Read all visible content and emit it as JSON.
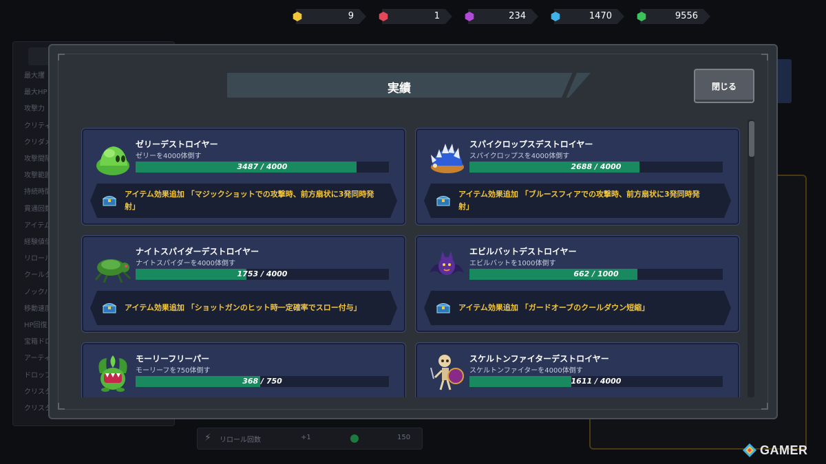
{
  "currency": [
    {
      "name": "yellow-gem",
      "value": "9",
      "color": "#f2c53a"
    },
    {
      "name": "red-gem",
      "value": "1",
      "color": "#e2475a"
    },
    {
      "name": "purple-gem",
      "value": "234",
      "color": "#b24ad8"
    },
    {
      "name": "blue-gem",
      "value": "1470",
      "color": "#3fb2e8"
    },
    {
      "name": "green-gem",
      "value": "9556",
      "color": "#3cc25a"
    }
  ],
  "modal": {
    "title": "実績",
    "close_label": "閉じる"
  },
  "achievements": [
    {
      "name": "ゼリーデストロイヤー",
      "desc": "ゼリーを4000体倒す",
      "progress": 3487,
      "goal": 4000,
      "progress_text": "3487 / 4000",
      "reward_1": "アイテム効果追加 「マジックショットでの攻撃時、前方扇状に3発同時発",
      "reward_2": "射」",
      "icon": "green-slime-icon"
    },
    {
      "name": "スパイクロップスデストロイヤー",
      "desc": "スパイクロップスを4000体倒す",
      "progress": 2688,
      "goal": 4000,
      "progress_text": "2688 / 4000",
      "reward_1": "アイテム効果追加 「ブルースフィアでの攻撃時、前方扇状に3発同時発",
      "reward_2": "射」",
      "icon": "spiked-shell-icon"
    },
    {
      "name": "ナイトスパイダーデストロイヤー",
      "desc": "ナイトスパイダーを4000体倒す",
      "progress": 1753,
      "goal": 4000,
      "progress_text": "1753 / 4000",
      "reward_1": "アイテム効果追加 「ショットガンのヒット時一定確率でスロー付与」",
      "reward_2": "",
      "icon": "green-spider-icon"
    },
    {
      "name": "エビルバットデストロイヤー",
      "desc": "エビルバットを1000体倒す",
      "progress": 662,
      "goal": 1000,
      "progress_text": "662 / 1000",
      "reward_1": "アイテム効果追加 「ガードオーブのクールダウン短縮」",
      "reward_2": "",
      "icon": "purple-bat-icon"
    },
    {
      "name": "モーリーフリーパー",
      "desc": "モーリーフを750体倒す",
      "progress": 368,
      "goal": 750,
      "progress_text": "368 / 750",
      "reward_1": "",
      "reward_2": "",
      "icon": "leaf-plant-icon"
    },
    {
      "name": "スケルトンファイターデストロイヤー",
      "desc": "スケルトンファイターを4000体倒す",
      "progress": 1611,
      "goal": 4000,
      "progress_text": "1611 / 4000",
      "reward_1": "",
      "reward_2": "",
      "icon": "skeleton-fighter-icon"
    }
  ],
  "background": {
    "stats": [
      "最大攫",
      "最大HP",
      "攻撃力",
      "クリティ",
      "クリダメ",
      "攻撃間隔",
      "攻撃範囲",
      "持続時間",
      "貫通回数",
      "アイテム",
      "経験値倍",
      "リロール",
      "クールタ",
      "ノックバ",
      "移動速度",
      "HP回復",
      "宝箱ドロ",
      "アーティ",
      "ドロップ",
      "クリスタ",
      "クリスタ"
    ],
    "reroll_label": "リロール回数",
    "reroll_plus": "+1",
    "reroll_cost": "150"
  },
  "watermark": "GAMER"
}
